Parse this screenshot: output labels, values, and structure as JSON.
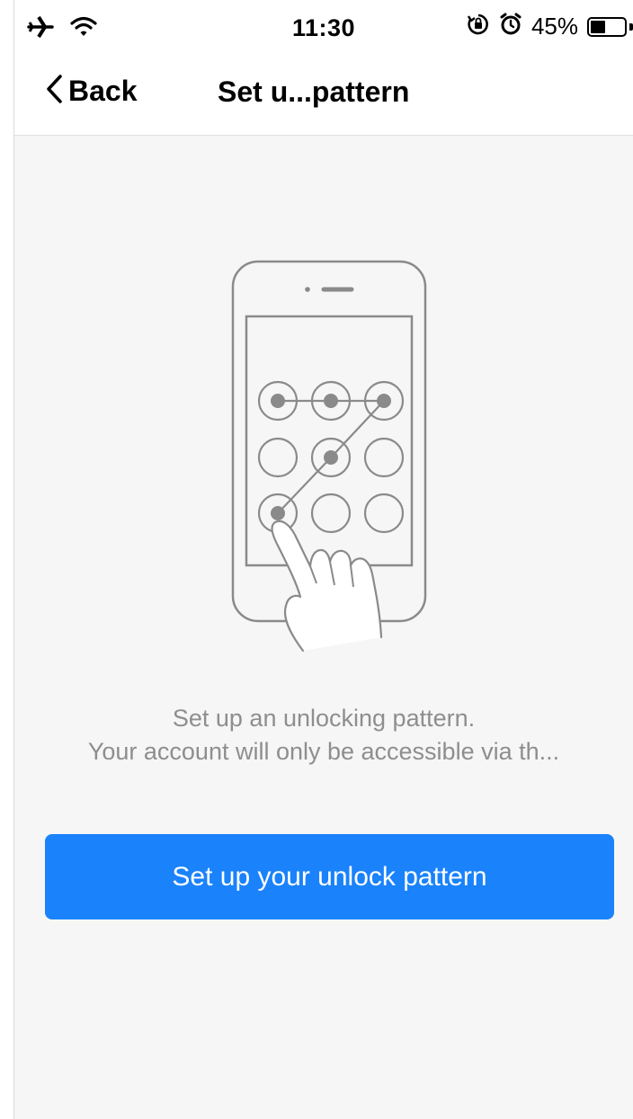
{
  "status_bar": {
    "time": "11:30",
    "battery_percent": "45%",
    "battery_level": 0.45,
    "icons": [
      "airplane-icon",
      "wifi-icon",
      "rotation-lock-icon",
      "alarm-icon",
      "battery-icon"
    ]
  },
  "nav": {
    "back_label": "Back",
    "title": "Set u...pattern"
  },
  "main": {
    "illustration_icon": "phone-unlock-pattern-icon",
    "description_line1": "Set up an unlocking pattern.",
    "description_line2": "Your account will only be accessible via th...",
    "button_label": "Set up your unlock pattern"
  },
  "colors": {
    "accent": "#1a82fb",
    "background": "#f6f6f6",
    "text_secondary": "#8e8e8e",
    "illustration_stroke": "#8a8a8a"
  }
}
